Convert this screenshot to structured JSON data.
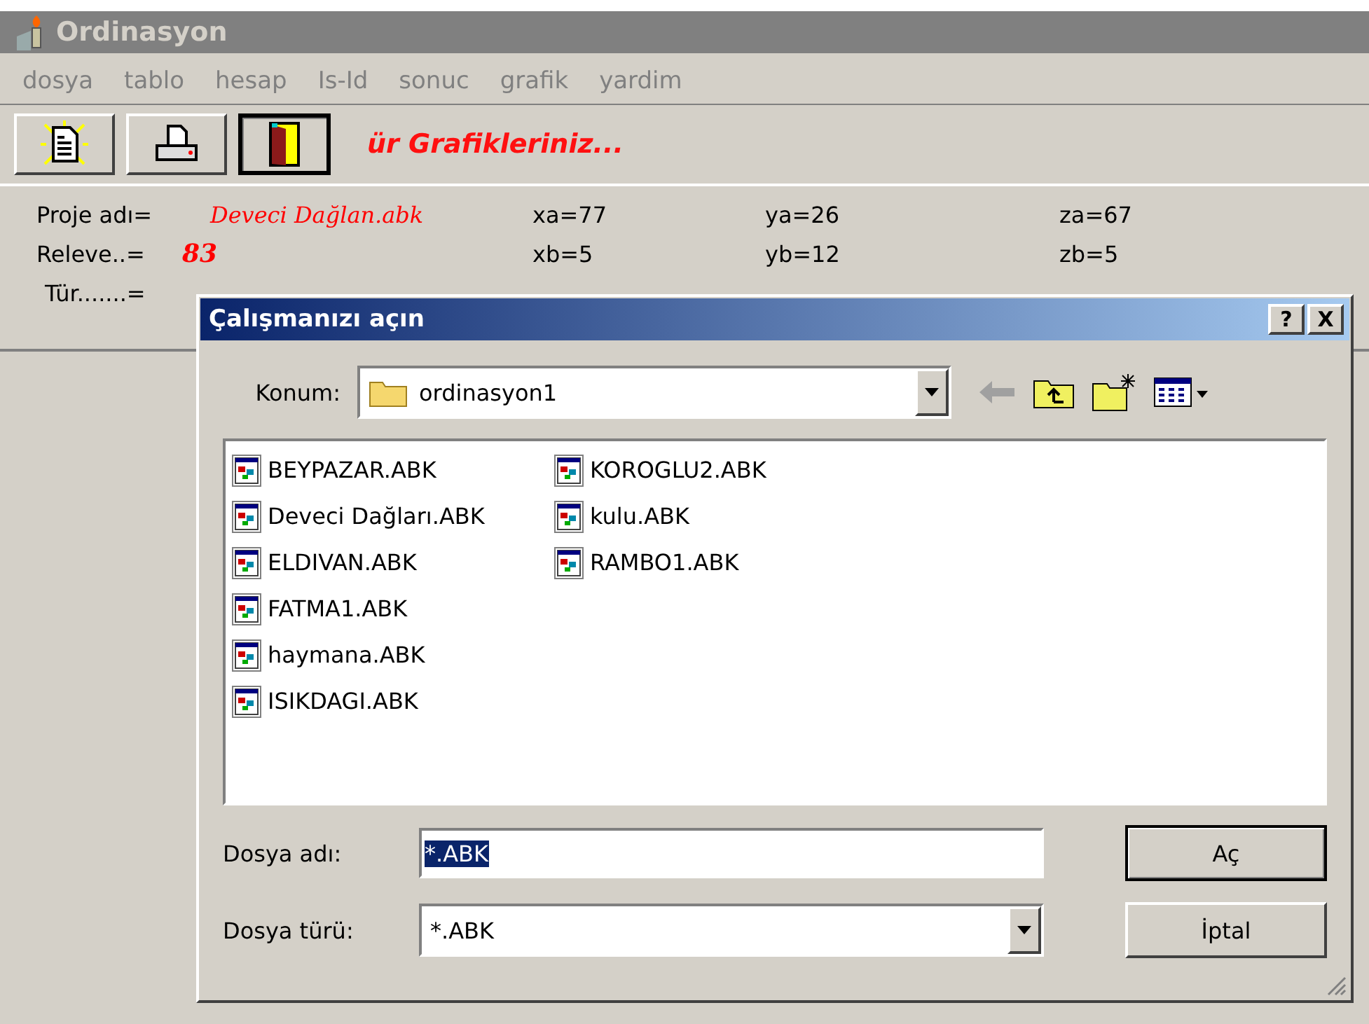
{
  "window": {
    "title": "Ordinasyon"
  },
  "menu": [
    "dosya",
    "tablo",
    "hesap",
    "Is-Id",
    "sonuc",
    "grafik",
    "yardim"
  ],
  "toolbar": {
    "buttons": [
      {
        "kind": "new",
        "pressed": false
      },
      {
        "kind": "print",
        "pressed": false
      },
      {
        "kind": "exit",
        "pressed": true
      }
    ],
    "caption": "ür  Grafikleriniz..."
  },
  "info": {
    "project_label": "Proje adı=",
    "project_value": "Deveci Dağlan.abk",
    "releve_label": "Releve..=",
    "releve_value": "83",
    "type_label": "Tür.......=",
    "values": [
      {
        "text": "xa=77"
      },
      {
        "text": "ya=26"
      },
      {
        "text": "za=67"
      },
      {
        "text": "xb=5"
      },
      {
        "text": "yb=12"
      },
      {
        "text": "zb=5"
      }
    ]
  },
  "dialog": {
    "title": "Çalışmanızı açın",
    "title_buttons": [
      "?",
      "X"
    ],
    "location_label": "Konum:",
    "location_value": "ordinasyon1",
    "files": [
      "BEYPAZAR.ABK",
      "Deveci Dağları.ABK",
      "ELDIVAN.ABK",
      "FATMA1.ABK",
      "haymana.ABK",
      "ISIKDAGI.ABK",
      "KOROGLU2.ABK",
      "kulu.ABK",
      "RAMBO1.ABK"
    ],
    "filename_label": "Dosya adı:",
    "filename_value": "*.ABK",
    "filename_text_selected": true,
    "filetype_label": "Dosya türü:",
    "filetype_value": "*.ABK",
    "buttons": [
      {
        "label": "Aç",
        "default": true
      },
      {
        "label": "İptal",
        "default": false
      }
    ]
  }
}
